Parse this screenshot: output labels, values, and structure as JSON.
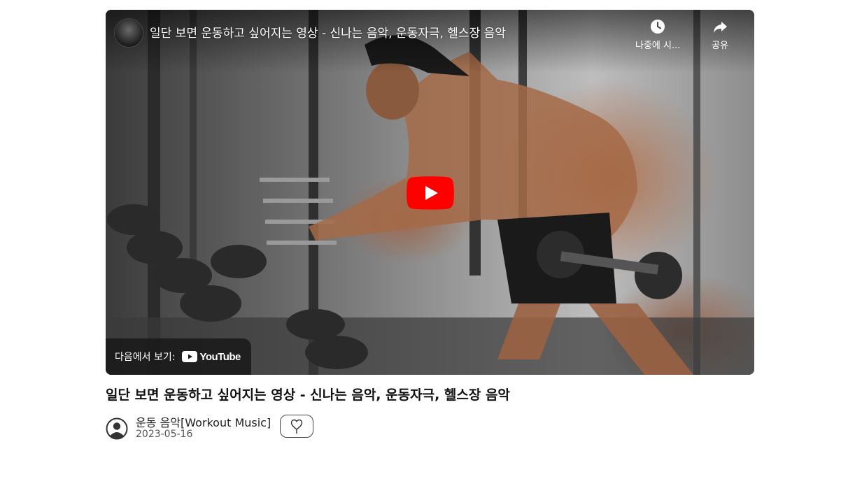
{
  "video": {
    "title": "일단 보면 운동하고 싶어지는 영상 - 신나는 음악, 운동자극, 헬스장 음악",
    "watch_later_label": "나중에 시...",
    "share_label": "공유",
    "watch_on_label": "다음에서 보기:",
    "youtube_wordmark": "YouTube",
    "play_icon": "play-icon",
    "colors": {
      "play_red": "#ff0000",
      "overlay_bg": "#171717"
    }
  },
  "post": {
    "title": "일단 보면 운동하고 싶어지는 영상 - 신나는 음악, 운동자극, 헬스장 음악",
    "author": "운동 음악[Workout Music]",
    "date": "2023-05-16",
    "like_icon": "heart-outline-icon",
    "avatar_icon": "user-circle-icon"
  }
}
